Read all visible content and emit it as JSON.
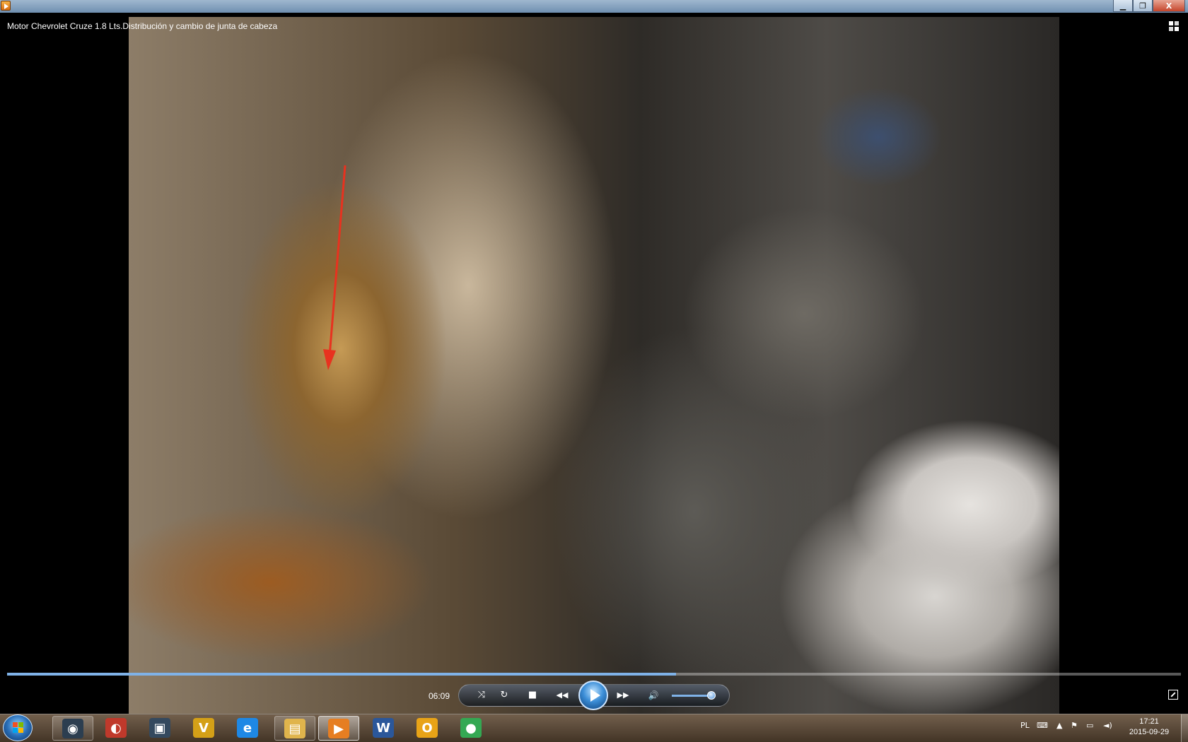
{
  "player": {
    "title": "Motor Chevrolet Cruze 1.8 Lts.Distribución y cambio de junta de cabeza",
    "current_time": "06:09",
    "progress_fraction": 0.57,
    "volume_fraction": 0.9
  },
  "window_controls": {
    "minimize_icon": "minimize-icon",
    "maximize_icon": "restore-down-icon",
    "close_label": "X"
  },
  "controls": {
    "shuffle_icon": "⤨",
    "repeat_icon": "↻",
    "stop_icon": "■",
    "previous_icon": "◀◀",
    "next_icon": "▶▶",
    "volume_icon": "🔊"
  },
  "taskbar": {
    "items": [
      {
        "name": "camera-app",
        "glyph": "◉",
        "color": "#2c3e50"
      },
      {
        "name": "opera",
        "glyph": "◐",
        "color": "#c0392b"
      },
      {
        "name": "virtualdub",
        "glyph": "▣",
        "color": "#34495e"
      },
      {
        "name": "vegas",
        "glyph": "V",
        "color": "#d4a017"
      },
      {
        "name": "internet-explorer",
        "glyph": "e",
        "color": "#1e88e5"
      },
      {
        "name": "file-explorer",
        "glyph": "▤",
        "color": "#e0b44c"
      },
      {
        "name": "media-player",
        "glyph": "▶",
        "color": "#e67e22"
      },
      {
        "name": "word",
        "glyph": "W",
        "color": "#2b579a"
      },
      {
        "name": "outlook",
        "glyph": "O",
        "color": "#e8a317"
      },
      {
        "name": "chrome",
        "glyph": "●",
        "color": "#34a853"
      }
    ],
    "language": "PL",
    "time": "17:21",
    "date": "2015-09-29"
  }
}
